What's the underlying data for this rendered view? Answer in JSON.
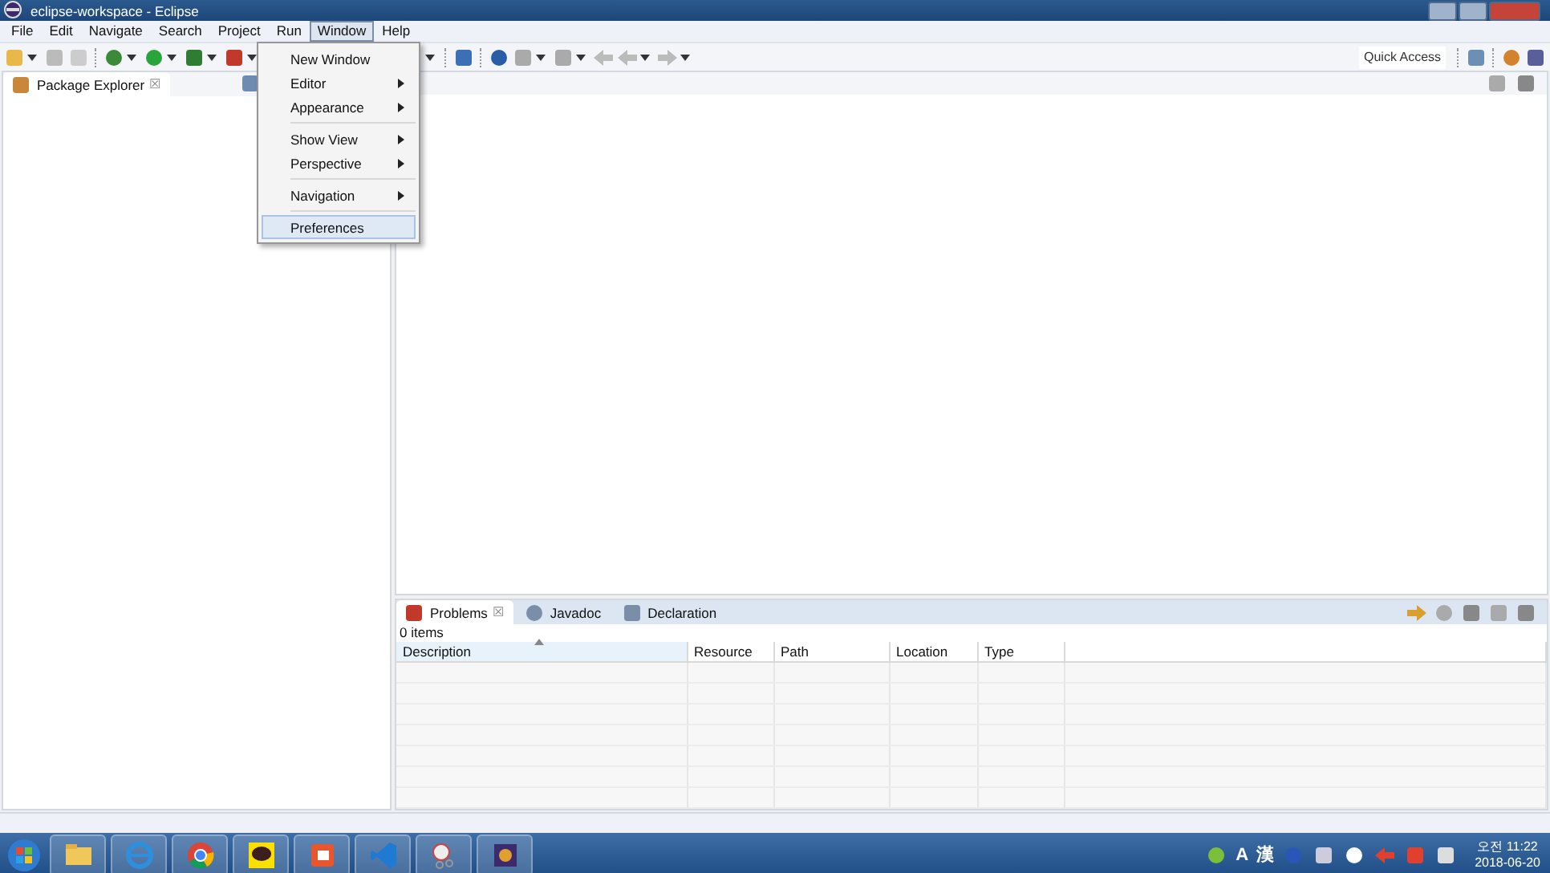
{
  "window": {
    "title": "eclipse-workspace - Eclipse"
  },
  "menu_bar": [
    {
      "label": "File",
      "selected": false
    },
    {
      "label": "Edit",
      "selected": false
    },
    {
      "label": "Navigate",
      "selected": false
    },
    {
      "label": "Search",
      "selected": false
    },
    {
      "label": "Project",
      "selected": false
    },
    {
      "label": "Run",
      "selected": false
    },
    {
      "label": "Window",
      "selected": true
    },
    {
      "label": "Help",
      "selected": false
    }
  ],
  "window_menu": {
    "groups": [
      [
        {
          "label": "New Window",
          "submenu": false,
          "selected": false
        },
        {
          "label": "Editor",
          "submenu": true,
          "selected": false
        },
        {
          "label": "Appearance",
          "submenu": true,
          "selected": false
        }
      ],
      [
        {
          "label": "Show View",
          "submenu": true,
          "selected": false
        },
        {
          "label": "Perspective",
          "submenu": true,
          "selected": false
        }
      ],
      [
        {
          "label": "Navigation",
          "submenu": true,
          "selected": false
        }
      ],
      [
        {
          "label": "Preferences",
          "submenu": false,
          "selected": true
        }
      ]
    ]
  },
  "toolbar": {
    "quick_access": {
      "placeholder": "Quick Access"
    }
  },
  "left_view": {
    "tab": {
      "label": "Package Explorer",
      "close": "☒"
    }
  },
  "bottom_panel": {
    "tabs": [
      {
        "label": "Problems",
        "selected": true
      },
      {
        "label": "Javadoc",
        "selected": false
      },
      {
        "label": "Declaration",
        "selected": false
      }
    ],
    "summary": "0 items",
    "columns": [
      "Description",
      "Resource",
      "Path",
      "Location",
      "Type"
    ]
  },
  "taskbar": {
    "tray": {
      "input_mode": "A",
      "hanja": "漢"
    },
    "clock": {
      "time": "오전 11:22",
      "date": "2018-06-20"
    }
  }
}
